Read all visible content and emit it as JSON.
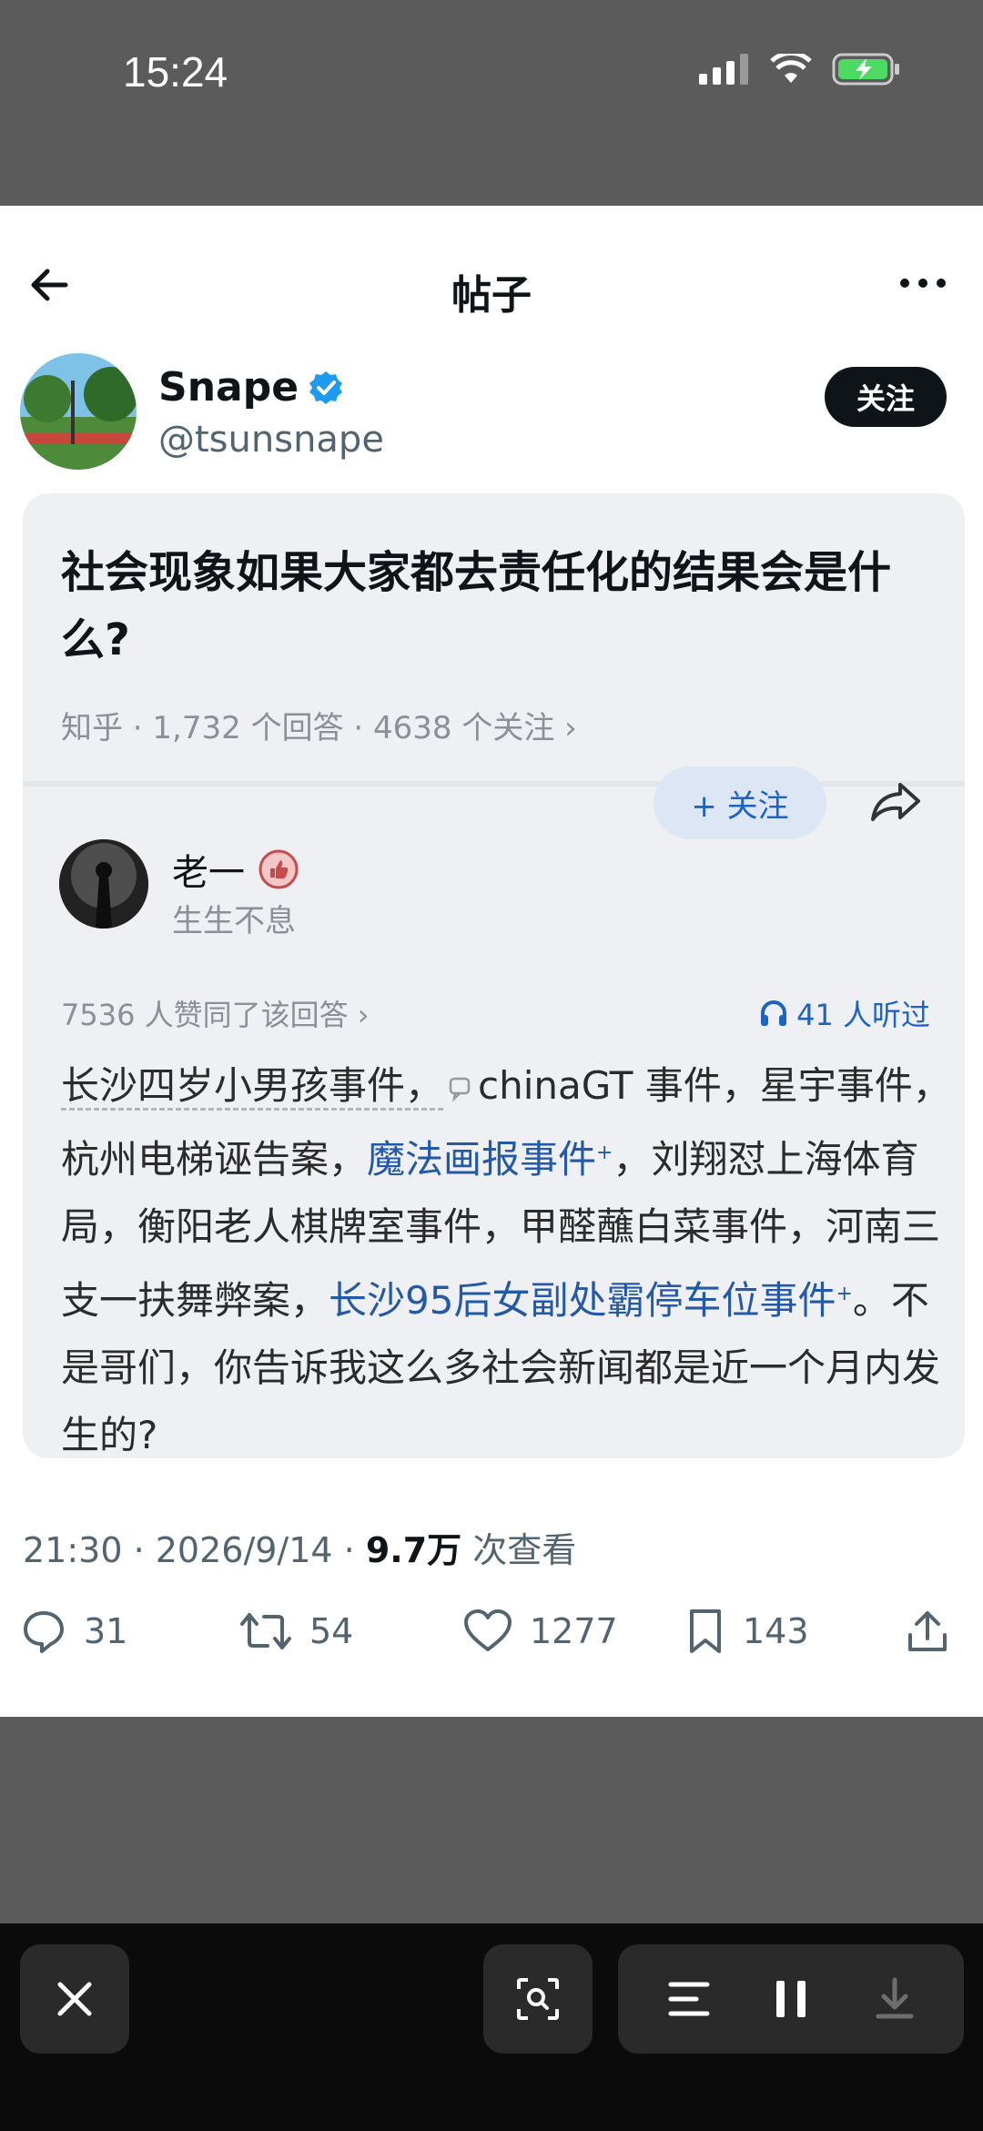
{
  "status_bar": {
    "time": "15:24",
    "icons": [
      "signal-icon",
      "wifi-icon",
      "battery-charging-icon"
    ]
  },
  "nav": {
    "title": "帖子"
  },
  "author": {
    "name": "Snape",
    "handle": "@tsunsnape",
    "follow_label": "关注",
    "verified": true
  },
  "quoted_card": {
    "question_title": "社会现象如果大家都去责任化的结果会是什么?",
    "question_meta": "知乎 · 1,732 个回答 · 4638 个关注 ›",
    "answerer": {
      "name": "老一",
      "subtitle": "生生不息",
      "follow_label": "+ 关注"
    },
    "agree_text": "7536 人赞同了该回答 ›",
    "listened_text": "41 人听过",
    "body": {
      "p1": "长沙四岁小男孩事件，",
      "p2": "chinaGT 事件，星宇事件，杭州电梯诬告案，",
      "link1": "魔法画报事件",
      "p3": "，刘翔怼上海体育局，衡阳老人棋牌室事件，甲醛蘸白菜事件，河南三支一扶舞弊案，",
      "link2": "长沙95后女副处霸停车位事件",
      "p4": "。不是哥们，你告诉我这么多社会新闻都是近一个月内发生的?",
      "sup": "+"
    }
  },
  "post_meta": {
    "time": "21:30 · 2026/9/14 · ",
    "views_count": "9.7万",
    "views_label": " 次查看"
  },
  "actions": {
    "replies": "31",
    "reposts": "54",
    "likes": "1277",
    "bookmarks": "143"
  },
  "colors": {
    "accent_blue": "#1d9bf0",
    "link_blue": "#2459a8",
    "dark": "#0f1419",
    "muted": "#536471"
  }
}
